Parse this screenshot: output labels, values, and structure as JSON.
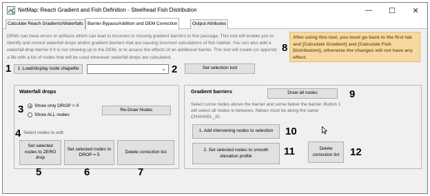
{
  "window": {
    "title": "NetMap: Reach Gradient and Fish Definition - Steelhead Fish Distribution",
    "minimize_glyph": "—",
    "maximize_glyph": "☐",
    "close_glyph": "✕"
  },
  "tabs": [
    {
      "label": "Calculate Reach Gradients/Waterfalls"
    },
    {
      "label": "Barrier Bypass/Addition and DEM Correction"
    },
    {
      "label": "Output Attributes"
    }
  ],
  "description": "DEMs can have errors or artifacts which can lead to incorrect or missing gradient barriers to fish passage. This tool will enable you to identify and correct waterfall drops and/or gradient barriers that are causing incorrect calculations of fish habitat. You can also add a waterfall drop barrier if it is not showing up in the DEM, or to assess the effects of an additional barrier. This tool will create (or append) a file with a list of nodes that will be used whenever waterfall drops are calculated.",
  "note": "After using this tool, you must go back to the first tab and [Calculate Gradient] and [Calculate Fish Distribution], otherwise the changes will not have any effect.",
  "toolbar": {
    "load_button": "1. Load/display node shapefile",
    "shapefile_select_value": "",
    "set_selection_button": "Set selection tool"
  },
  "waterfall": {
    "title": "Waterfall drops",
    "radio_drop": "Show only DROP > 0",
    "radio_all": "Show ALL nodes",
    "redraw_button": "Re-Draw Nodes",
    "select_hint": "Select nodes to edit",
    "zero_drop_button": "Set selected nodes to ZERO drop",
    "drop5_button": "Set selected nodes to DROP = 5",
    "delete_button": "Delete correction list"
  },
  "gradient": {
    "title": "Gradient barriers",
    "draw_all_button": "Draw all nodes",
    "description": "Select some nodes above the barrier and some below the barrier. Button 1 will select all nodes in between. Ndoes must be along the same CHANNEL_ID.",
    "add_nodes_button": "1. Add intervening nodes to selection",
    "smooth_button": "2. Set selected nodes to smooth elevation profile",
    "delete_button": "Delete correction list"
  },
  "annotations": {
    "n1": "1",
    "n2": "2",
    "n3": "3",
    "n4": "4",
    "n5": "5",
    "n6": "6",
    "n7": "7",
    "n8": "8",
    "n9": "9",
    "n10": "10",
    "n11": "11",
    "n12": "12"
  }
}
